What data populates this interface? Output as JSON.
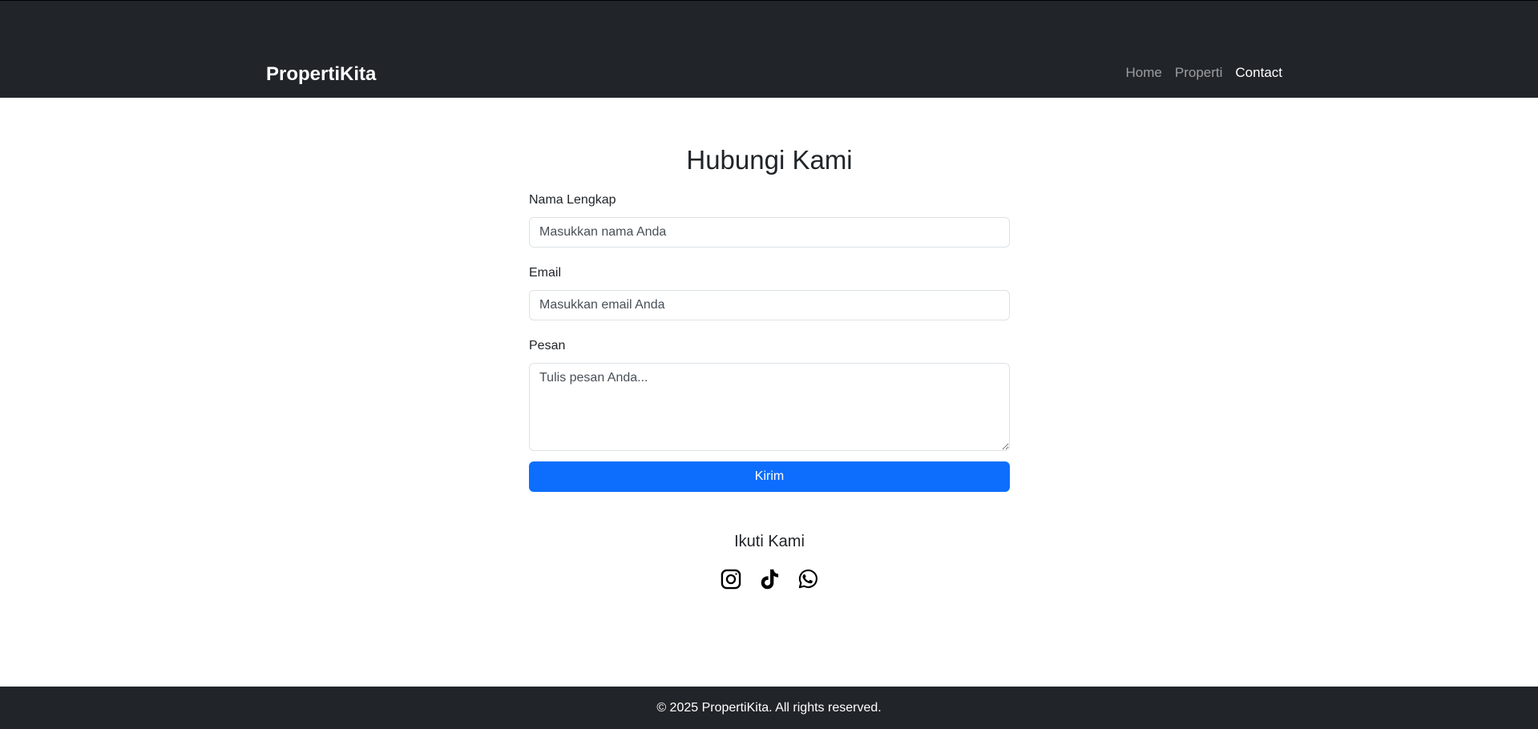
{
  "navbar": {
    "brand": "PropertiKita",
    "links": [
      {
        "label": "Home",
        "active": false
      },
      {
        "label": "Properti",
        "active": false
      },
      {
        "label": "Contact",
        "active": true
      }
    ]
  },
  "contact": {
    "title": "Hubungi Kami",
    "name_label": "Nama Lengkap",
    "name_placeholder": "Masukkan nama Anda",
    "email_label": "Email",
    "email_placeholder": "Masukkan email Anda",
    "message_label": "Pesan",
    "message_placeholder": "Tulis pesan Anda...",
    "submit_label": "Kirim"
  },
  "social": {
    "title": "Ikuti Kami",
    "icons": [
      "instagram-icon",
      "tiktok-icon",
      "whatsapp-icon"
    ]
  },
  "footer": {
    "text": "© 2025 PropertiKita. All rights reserved."
  },
  "colors": {
    "navbar_bg": "#212529",
    "primary": "#0d6efd"
  }
}
